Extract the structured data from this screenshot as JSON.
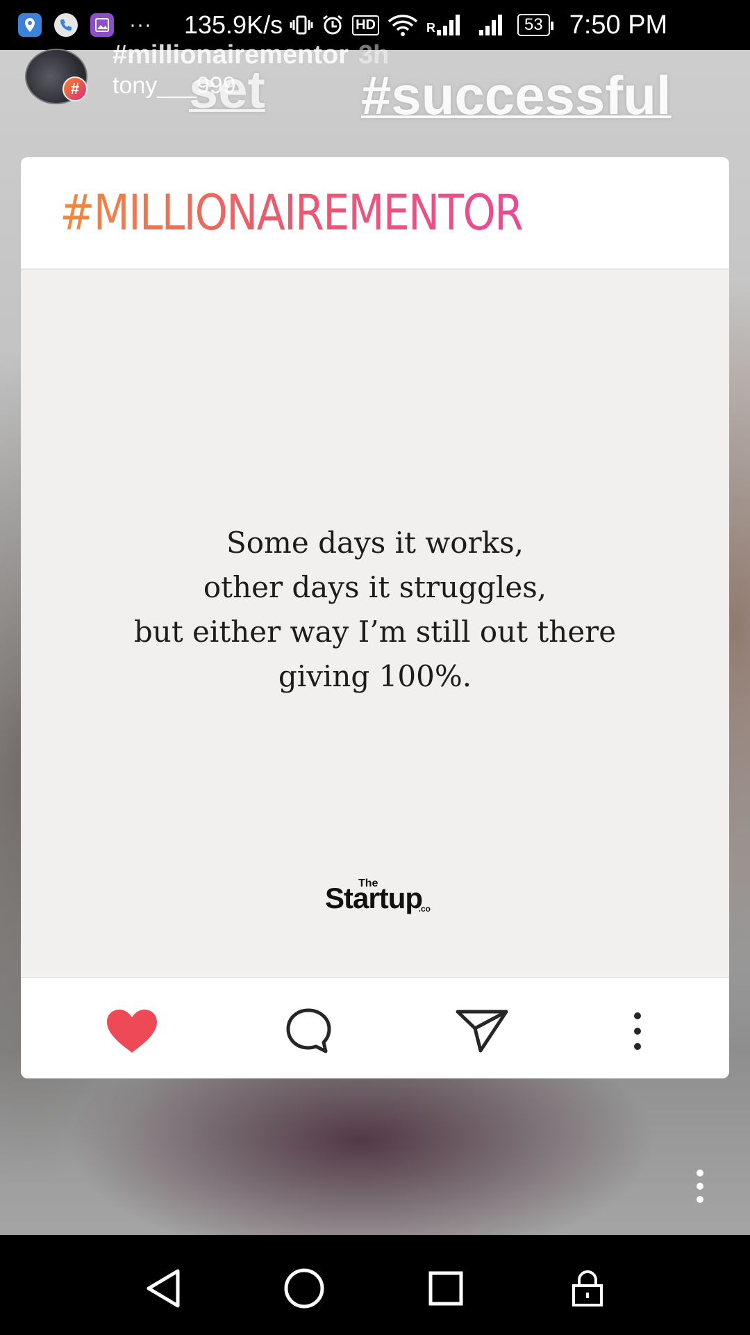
{
  "status_bar": {
    "notification_icons": [
      "location-pin-icon",
      "phone-icon",
      "gallery-icon"
    ],
    "more_dots": "···",
    "network_speed": "135.9K/s",
    "hd_label": "HD",
    "roaming_label": "R",
    "battery_level": "53",
    "time": "7:50 PM"
  },
  "story": {
    "hashtag_name": "#millionairementor",
    "time_ago": "3h",
    "username": "tony___999",
    "avatar_badge": "#",
    "overlay_texts": [
      "set",
      "#successful"
    ]
  },
  "post": {
    "brand_title": "#MILLIONAIREMENTOR",
    "quote_lines": [
      "Some days it works,",
      "other days it struggles,",
      "but either way I’m still out there",
      "giving 100%."
    ],
    "logo": {
      "prefix": "The",
      "name": "Startup",
      "suffix": ".co"
    },
    "actions": [
      "heart-icon",
      "comment-icon",
      "send-icon",
      "more-vertical-icon"
    ],
    "liked": true,
    "like_color": "#ed4956"
  },
  "nav_bar": {
    "buttons": [
      "back-icon",
      "home-icon",
      "recents-icon",
      "lock-icon"
    ]
  },
  "colors": {
    "brand_gradient_start": "#f08a3c",
    "brand_gradient_end": "#e94b96"
  }
}
